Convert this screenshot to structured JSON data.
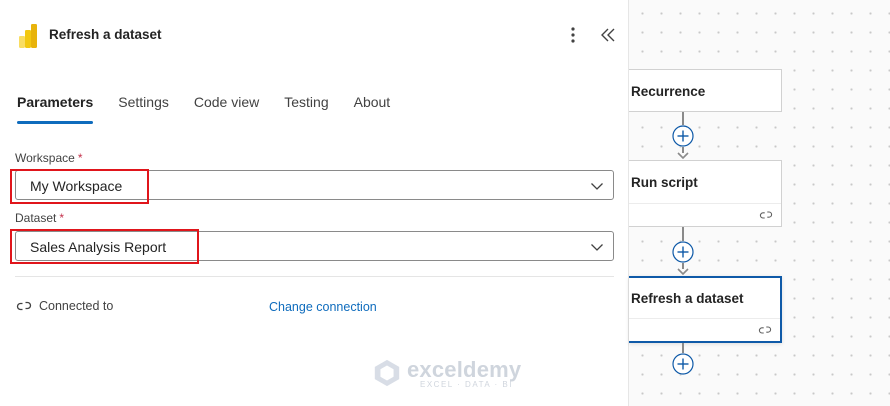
{
  "panel": {
    "title": "Refresh a dataset",
    "tabs": [
      {
        "label": "Parameters",
        "active": true
      },
      {
        "label": "Settings"
      },
      {
        "label": "Code view"
      },
      {
        "label": "Testing"
      },
      {
        "label": "About"
      }
    ],
    "workspace": {
      "label": "Workspace",
      "required_mark": "*",
      "value": "My Workspace"
    },
    "dataset": {
      "label": "Dataset",
      "required_mark": "*",
      "value": "Sales Analysis Report"
    },
    "connection": {
      "label": "Connected to",
      "link": "Change connection"
    }
  },
  "flow": {
    "steps": [
      {
        "title": "Recurrence"
      },
      {
        "title": "Run script"
      },
      {
        "title": "Refresh a dataset",
        "selected": true
      }
    ]
  },
  "watermark": {
    "name": "exceldemy",
    "tagline": "EXCEL · DATA · BI"
  },
  "colors": {
    "accent": "#0f6cbd",
    "highlight_box": "#e0151b",
    "required": "#c4314b",
    "selected_card_border": "#0f5aa8",
    "logo_yellow": "#f2c811"
  },
  "icons": {
    "logo": "power-bi-logo-icon",
    "more": "more-vertical-icon",
    "collapse": "double-chevron-left-icon",
    "dropdown": "chevron-down-icon",
    "connection": "link-icon",
    "add": "add-circle-icon"
  }
}
